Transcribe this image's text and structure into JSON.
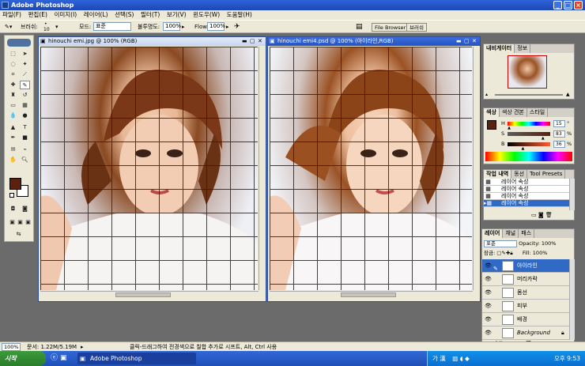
{
  "app": {
    "title": "Adobe Photoshop"
  },
  "menu": [
    "파일(F)",
    "편집(E)",
    "이미지(I)",
    "레이어(L)",
    "선택(S)",
    "필터(T)",
    "보기(V)",
    "윈도우(W)",
    "도움말(H)"
  ],
  "options": {
    "brush_label": "브러쉬:",
    "brush_size": "10",
    "mode_label": "모드:",
    "mode_value": "표준",
    "opacity_label": "불투명도:",
    "opacity_value": "100%",
    "flow_label": "Flow:",
    "flow_value": "100%",
    "file_browser_label": "File Browser",
    "brushes_tab_label": "브러쉬"
  },
  "doc1": {
    "title": "hinouchi emi.jpg @ 100% (RGB)"
  },
  "doc2": {
    "title": "hinouchi emi4.psd @ 100% (아이라인,RGB)"
  },
  "navigator": {
    "tabs": [
      "내비게이터",
      "정보"
    ]
  },
  "color_panel": {
    "tabs": [
      "색상",
      "색상 견본",
      "스타일"
    ],
    "channels": [
      {
        "label": "H",
        "value": "15",
        "unit": "°",
        "fraction": 0.04
      },
      {
        "label": "S",
        "value": "83",
        "unit": "%",
        "fraction": 0.83
      },
      {
        "label": "B",
        "value": "36",
        "unit": "%",
        "fraction": 0.36
      }
    ],
    "foreground_color": "#5c200f"
  },
  "history": {
    "tabs": [
      "작업 내역",
      "동선",
      "Tool Presets"
    ],
    "items": [
      "레이어 속성",
      "레이어 속성",
      "레이어 속성",
      "레이어 속성"
    ]
  },
  "layers": {
    "tabs": [
      "레이어",
      "채널",
      "패스"
    ],
    "blend_mode": "표준",
    "opacity_label": "Opacity:",
    "opacity_value": "100%",
    "lock_label": "잠금:",
    "fill_label": "Fill:",
    "fill_value": "100%",
    "items": [
      {
        "name": "아이라인",
        "selected": true
      },
      {
        "name": "머리카락",
        "selected": false
      },
      {
        "name": "몸선",
        "selected": false
      },
      {
        "name": "피부",
        "selected": false
      },
      {
        "name": "배경",
        "selected": false
      },
      {
        "name": "Background",
        "selected": false
      }
    ]
  },
  "status": {
    "zoom": "100%",
    "doc_size": "문서: 1.22M/5.19M",
    "hint": "클릭-드래그하여 전경색으로 칠합 추가로 시프트, Alt, Ctrl 사용"
  },
  "taskbar": {
    "start_label": "시작",
    "task_label": "Adobe Photoshop",
    "ime": "가 漢",
    "clock": "오후 9:53"
  }
}
